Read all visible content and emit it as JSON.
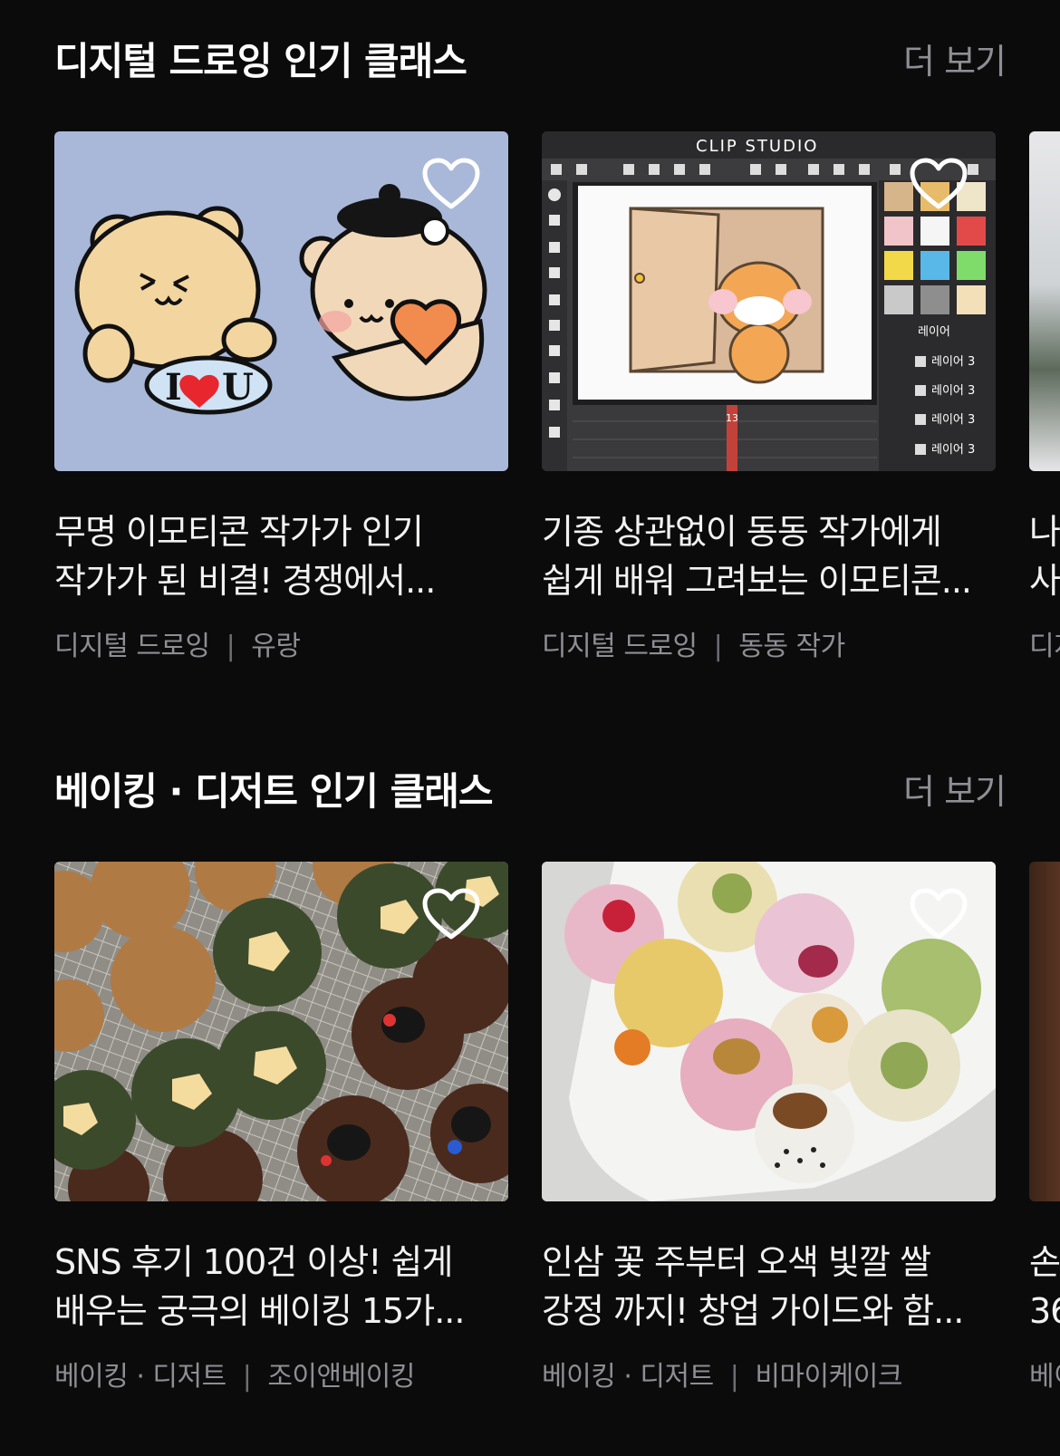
{
  "sections": [
    {
      "title": "디지털 드로잉 인기 클래스",
      "more_label": "더 보기",
      "cards": [
        {
          "title_line1": "무명 이모티콘 작가가 인기",
          "title_line2": "작가가 된 비결! 경쟁에서...",
          "category": "디지털 드로잉",
          "author": "유랑",
          "image_label": "I ♥ U"
        },
        {
          "title_line1": "기종 상관없이 동동 작가에게",
          "title_line2": "쉽게 배워 그려보는 이모티콘...",
          "category": "디지털 드로잉",
          "author": "동동 작가",
          "app_name": "CLIP STUDIO",
          "layers_header": "레이어",
          "layer_label": "레이어 3",
          "frame_number": "13"
        },
        {
          "title_line1": "나",
          "title_line2": "사",
          "category": "디지",
          "author": ""
        }
      ]
    },
    {
      "title": "베이킹 · 디저트 인기 클래스",
      "more_label": "더 보기",
      "cards": [
        {
          "title_line1": "SNS 후기 100건 이상! 쉽게",
          "title_line2": "배우는 궁극의 베이킹 15가...",
          "category": "베이킹 · 디저트",
          "author": "조이앤베이킹"
        },
        {
          "title_line1": "인삼 꽃 주부터 오색 빛깔 쌀",
          "title_line2": "강정 까지! 창업 가이드와 함...",
          "category": "베이킹 · 디저트",
          "author": "비마이케이크"
        },
        {
          "title_line1": "손",
          "title_line2": "36",
          "category": "베이",
          "author": ""
        }
      ]
    }
  ],
  "icons": {
    "favorite": "heart-outline-icon"
  }
}
